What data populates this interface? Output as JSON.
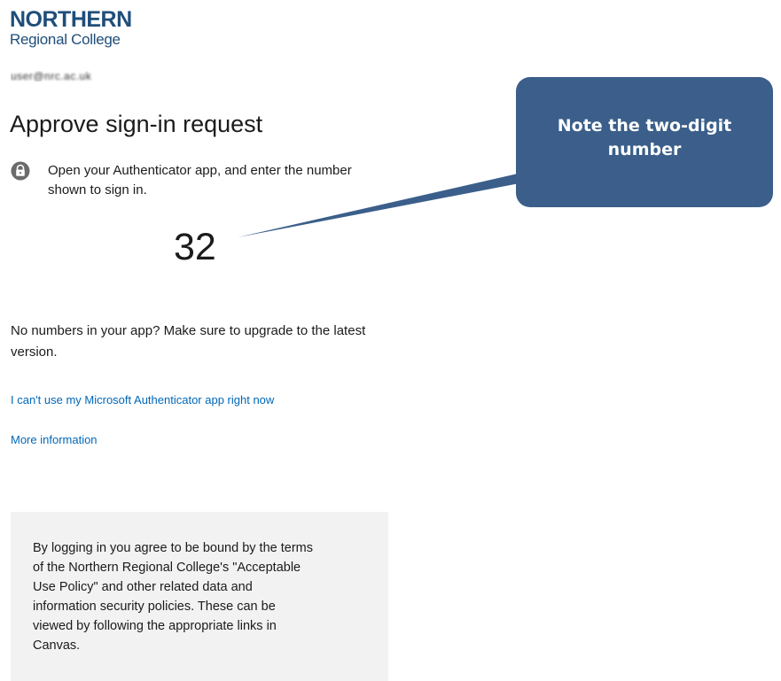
{
  "branding": {
    "logo_line1": "NORTHERN",
    "logo_line2": "Regional College",
    "color": "#1f4e7a"
  },
  "account": {
    "identifier": "user@nrc.ac.uk"
  },
  "signin": {
    "title": "Approve sign-in request",
    "lock_icon": "lock-icon",
    "instruction": "Open your Authenticator app, and enter the number shown to sign in.",
    "number": "32",
    "upgrade_text": "No numbers in your app? Make sure to upgrade to the latest version.",
    "cant_use_link": "I can't use my Microsoft Authenticator app right now",
    "more_info_link": "More information",
    "link_color": "#0067b8"
  },
  "footer": {
    "policy_text": "By logging in you agree to be bound by the terms of the Northern Regional College's \"Acceptable Use Policy\" and other related data and information security policies. These can be viewed by following the appropriate links in Canvas."
  },
  "annotation": {
    "callout_text": "Note the two-digit number",
    "color": "#3b5f8a"
  }
}
